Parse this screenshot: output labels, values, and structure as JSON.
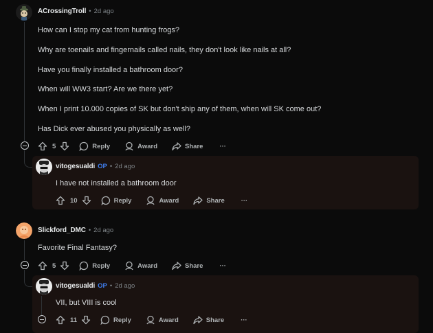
{
  "comments": [
    {
      "author": "ACrossingTroll",
      "time": "2d ago",
      "paragraphs": [
        "How can I stop my cat from hunting frogs?",
        "Why are toenails and fingernails called nails, they don't look like nails at all?",
        "Have you finally installed a bathroom door?",
        "When will WW3 start? Are we there yet?",
        "When I print 10.000 copies of SK but don't ship any of them, when will SK come out?",
        "Has Dick ever abused you physically as well?"
      ],
      "votes": "5",
      "reply": {
        "author": "vitogesualdi",
        "badge": "OP",
        "time": "2d ago",
        "text": "I have not installed a bathroom door",
        "votes": "10"
      }
    },
    {
      "author": "Slickford_DMC",
      "time": "2d ago",
      "paragraphs": [
        "Favorite Final Fantasy?"
      ],
      "votes": "5",
      "reply": {
        "author": "vitogesualdi",
        "badge": "OP",
        "time": "2d ago",
        "text": "VII, but VIII is cool",
        "votes": "11"
      }
    }
  ],
  "actions": {
    "reply": "Reply",
    "award": "Award",
    "share": "Share",
    "more": "···",
    "dot": "•"
  },
  "colors": {
    "op_badge": "#3f7ff0",
    "reply_bg": "#1a1210",
    "slickford_avatar": "#f4a46a"
  }
}
